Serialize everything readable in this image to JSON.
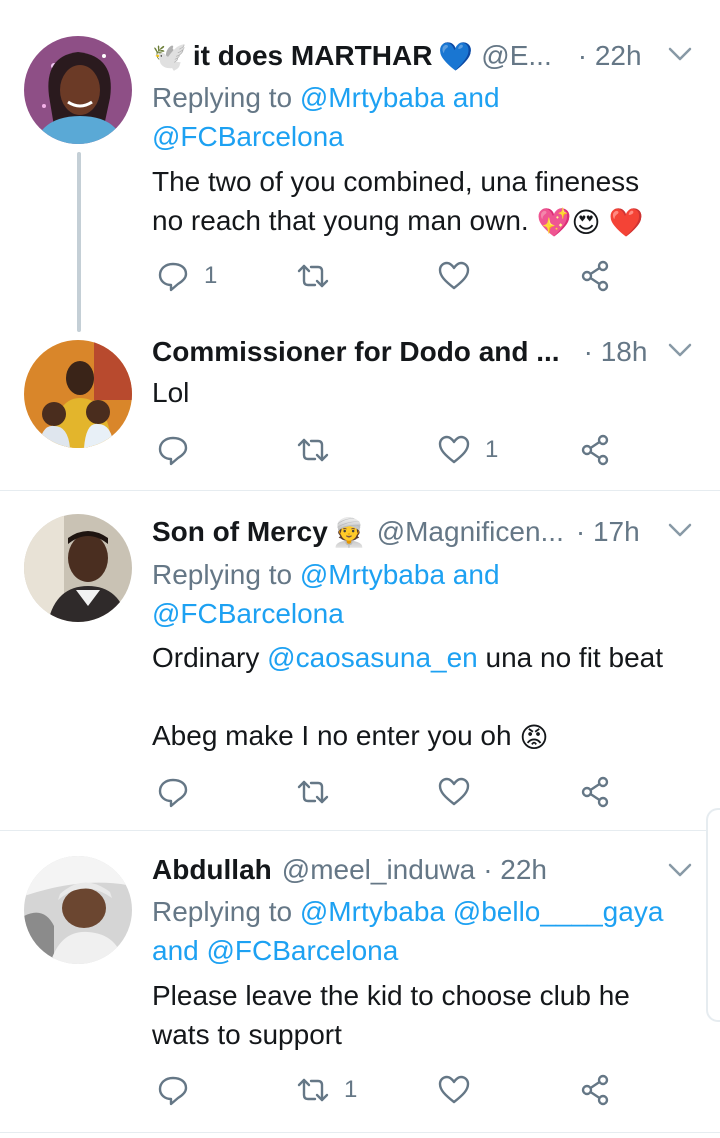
{
  "colors": {
    "text": "#14171a",
    "muted": "#657786",
    "link": "#1da1f2",
    "divider": "#e6ecf0",
    "thread_line": "#c4cfd6"
  },
  "tweets": [
    {
      "name": "it does MARTHAR",
      "name_prefix_emoji": "🕊️",
      "name_suffix_emoji": "💙",
      "handle": "@E...",
      "time": "· 22h",
      "replying_prefix": "Replying to ",
      "replying_to_1": "@Mrtybaba",
      "replying_and": " and",
      "replying_to_2": "@FCBarcelona",
      "text_line_1": "The two of you combined, una fineness",
      "text_line_2": "no reach that young man own.",
      "text_emojis": [
        "💖",
        "😍",
        "❤️"
      ],
      "reply_count": "1",
      "retweet_count": "",
      "like_count": "",
      "avatar_icon": "woman-avatar"
    },
    {
      "name": "Commissioner for Dodo and ...",
      "time": "· 18h",
      "text_line_1": "Lol",
      "reply_count": "",
      "retweet_count": "",
      "like_count": "1",
      "avatar_icon": "man-with-babies-avatar"
    },
    {
      "name": "Son of Mercy",
      "name_suffix_emoji": "👳",
      "handle": "@Magnificen...",
      "time": "· 17h",
      "replying_prefix": "Replying to ",
      "replying_to_1": "@Mrtybaba",
      "replying_and": " and",
      "replying_to_2": "@FCBarcelona",
      "text_line_1_a": "Ordinary ",
      "text_line_1_mention": "@caosasuna_en",
      "text_line_1_b": " una no fit beat",
      "text_line_2": "Abeg make I no enter you oh",
      "text_emoji": "😡",
      "reply_count": "",
      "retweet_count": "",
      "like_count": "",
      "avatar_icon": "man-avatar"
    },
    {
      "name": "Abdullah",
      "handle": "@meel_induwa",
      "time": "· 22h",
      "replying_prefix": "Replying to ",
      "replying_to_1": "@Mrtybaba",
      "replying_to_2": "@bello____gaya",
      "replying_and": "and ",
      "replying_to_3": "@FCBarcelona",
      "text_line_1": "Please leave the kid to choose club he",
      "text_line_2": "wats to support",
      "reply_count": "",
      "retweet_count": "1",
      "like_count": "",
      "avatar_icon": "man-in-car-avatar"
    }
  ]
}
